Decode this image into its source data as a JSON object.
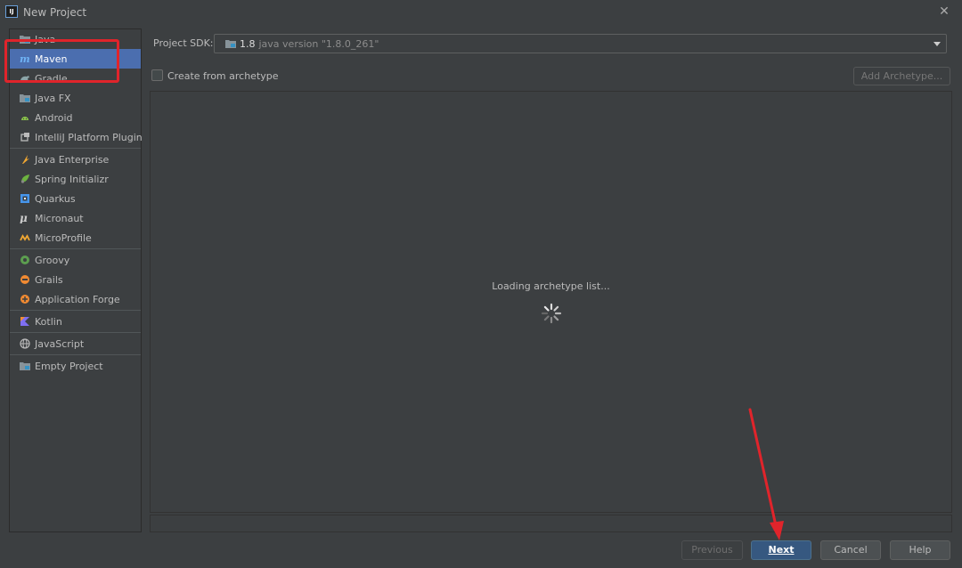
{
  "window": {
    "title": "New Project",
    "app_logo": "IJ"
  },
  "sidebar": {
    "groups": [
      [
        {
          "label": "Java",
          "icon": "folder-icon"
        },
        {
          "label": "Maven",
          "icon": "maven-icon",
          "selected": true
        },
        {
          "label": "Gradle",
          "icon": "gradle-icon"
        },
        {
          "label": "Java FX",
          "icon": "folder-icon"
        },
        {
          "label": "Android",
          "icon": "android-icon"
        },
        {
          "label": "IntelliJ Platform Plugin",
          "icon": "plugin-icon"
        }
      ],
      [
        {
          "label": "Java Enterprise",
          "icon": "java-enterprise-icon"
        },
        {
          "label": "Spring Initializr",
          "icon": "spring-icon"
        },
        {
          "label": "Quarkus",
          "icon": "quarkus-icon"
        },
        {
          "label": "Micronaut",
          "icon": "micronaut-icon"
        },
        {
          "label": "MicroProfile",
          "icon": "microprofile-icon"
        }
      ],
      [
        {
          "label": "Groovy",
          "icon": "groovy-icon"
        },
        {
          "label": "Grails",
          "icon": "grails-icon"
        },
        {
          "label": "Application Forge",
          "icon": "forge-icon"
        }
      ],
      [
        {
          "label": "Kotlin",
          "icon": "kotlin-icon"
        }
      ],
      [
        {
          "label": "JavaScript",
          "icon": "globe-icon"
        }
      ],
      [
        {
          "label": "Empty Project",
          "icon": "folder-icon"
        }
      ]
    ]
  },
  "sdk": {
    "label": "Project SDK:",
    "version": "1.8",
    "detail": "java version \"1.8.0_261\""
  },
  "archetype": {
    "checkbox_label": "Create from archetype",
    "checked": false,
    "add_button": "Add Archetype...",
    "loading_text": "Loading archetype list..."
  },
  "buttons": {
    "previous": "Previous",
    "next": "Next",
    "cancel": "Cancel",
    "help": "Help"
  },
  "colors": {
    "selection": "#4b6eaf",
    "annotation": "#e0242b",
    "primary_button": "#365880"
  }
}
